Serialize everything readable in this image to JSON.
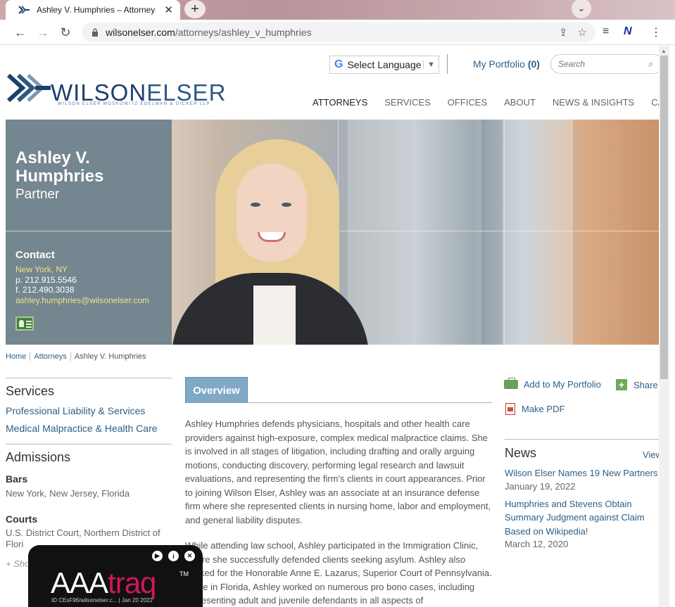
{
  "browser": {
    "tab_title": "Ashley V. Humphries – Attorney",
    "new_tab_label": "+",
    "url_domain": "wilsonelser.com",
    "url_path": "/attorneys/ashley_v_humphries"
  },
  "header": {
    "language_label": "Select Language",
    "portfolio_label": "My Portfolio",
    "portfolio_count": "(0)",
    "search_placeholder": "Search",
    "logo_wilson": "WILSON",
    "logo_elser": "ELSER",
    "logo_sub": "WILSON ELSER MOSKOWITZ EDELMAN & DICKER LLP",
    "nav": [
      "ATTORNEYS",
      "SERVICES",
      "OFFICES",
      "ABOUT",
      "NEWS & INSIGHTS",
      "CAREE"
    ]
  },
  "profile": {
    "name_line1": "Ashley V.",
    "name_line2": "Humphries",
    "title": "Partner",
    "contact_heading": "Contact",
    "city": "New York, NY",
    "phone": "p. 212.915.5546",
    "fax": "f.  212.490.3038",
    "email": "ashley.humphries@wilsonelser.com"
  },
  "breadcrumb": [
    "Home",
    "Attorneys",
    "Ashley V. Humphries"
  ],
  "sidebar": {
    "services_heading": "Services",
    "services": [
      "Professional Liability & Services",
      "Medical Malpractice & Health Care"
    ],
    "admissions_heading": "Admissions",
    "bars_heading": "Bars",
    "bars_text": "New York, New Jersey, Florida",
    "courts_heading": "Courts",
    "courts_text": "U.S. District Court, Northern District of Flori",
    "show_more": "+ Sho"
  },
  "content": {
    "tab_overview": "Overview",
    "para1": "Ashley Humphries defends physicians, hospitals and other health care providers against high-exposure, complex medical malpractice claims. She is involved in all stages of litigation, including drafting and orally arguing motions, conducting discovery, performing legal research and lawsuit evaluations, and representing the firm's clients in court appearances. Prior to joining Wilson Elser, Ashley was an associate at an insurance defense firm where she represented clients in nursing home, labor and employment, and general liability disputes.",
    "para2": "While attending law school, Ashley participated in the Immigration Clinic, where she successfully defended clients seeking asylum. Ashley also clerked for the Honorable Anne E. Lazarus, Superior Court of Pennsylvania. While in Florida, Ashley worked on numerous pro bono cases, including representing adult and juvenile defendants in all aspects of"
  },
  "actions": {
    "add_portfolio": "Add to My Portfolio",
    "share": "Share",
    "make_pdf": "Make PDF"
  },
  "news": {
    "heading": "News",
    "view_all": "View",
    "items": [
      {
        "title": "Wilson Elser Names 19 New Partners",
        "date": "January 19, 2022"
      },
      {
        "title": "Humphries and Stevens Obtain Summary Judgment against Claim Based on Wikipedia!",
        "date": "March 12, 2020"
      }
    ]
  },
  "overlay": {
    "brand_aaa": "AAA",
    "brand_traq": "traq",
    "tm": "TM",
    "meta": "ID CEsF96/wilsonelser.c...  | Jan 20 2022"
  }
}
